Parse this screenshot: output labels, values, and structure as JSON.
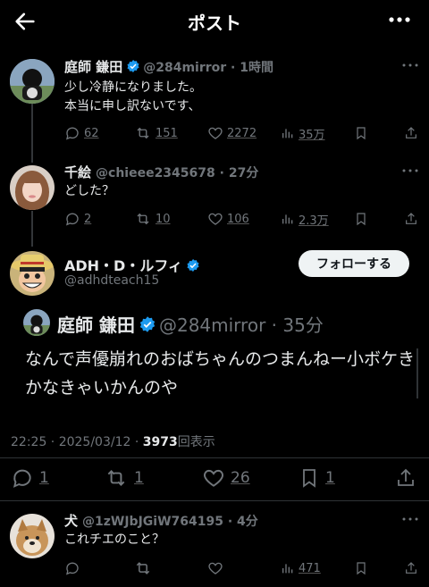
{
  "header": {
    "title": "ポスト"
  },
  "posts": [
    {
      "name": "庭師 鎌田",
      "handle": "@284mirror",
      "time": "1時間",
      "lines": [
        "少し冷静になりました。",
        "本当に申し訳ないです、"
      ],
      "replies": "62",
      "reposts": "151",
      "likes": "2272",
      "views": "35万"
    },
    {
      "name": "千絵",
      "handle": "@chieee2345678",
      "time": "27分",
      "lines": [
        "どした？"
      ],
      "replies": "2",
      "reposts": "10",
      "likes": "106",
      "views": "2.3万"
    }
  ],
  "main_post": {
    "name": "ADH・D・ルフィ",
    "handle": "@adhdteach15",
    "follow_label": "フォローする",
    "quote": {
      "name": "庭師 鎌田",
      "handle": "@284mirror",
      "time": "35分",
      "text": "なんで声優崩れのおばちゃんのつまんねー小ボケきかなきゃいかんのや"
    },
    "timestamp": "22:25 · 2025/03/12 · ",
    "view_count": "3973",
    "view_label": "回表示",
    "replies": "1",
    "reposts": "1",
    "likes": "26",
    "bookmarks": "1"
  },
  "reply": {
    "name": "犬",
    "handle": "@1zWJbJGiW764195",
    "time": "4分",
    "text": "これチエのこと？",
    "views": "471"
  },
  "colors": {
    "verified": "#1d9bf0",
    "muted": "#71767b",
    "text": "#e7e9ea"
  }
}
